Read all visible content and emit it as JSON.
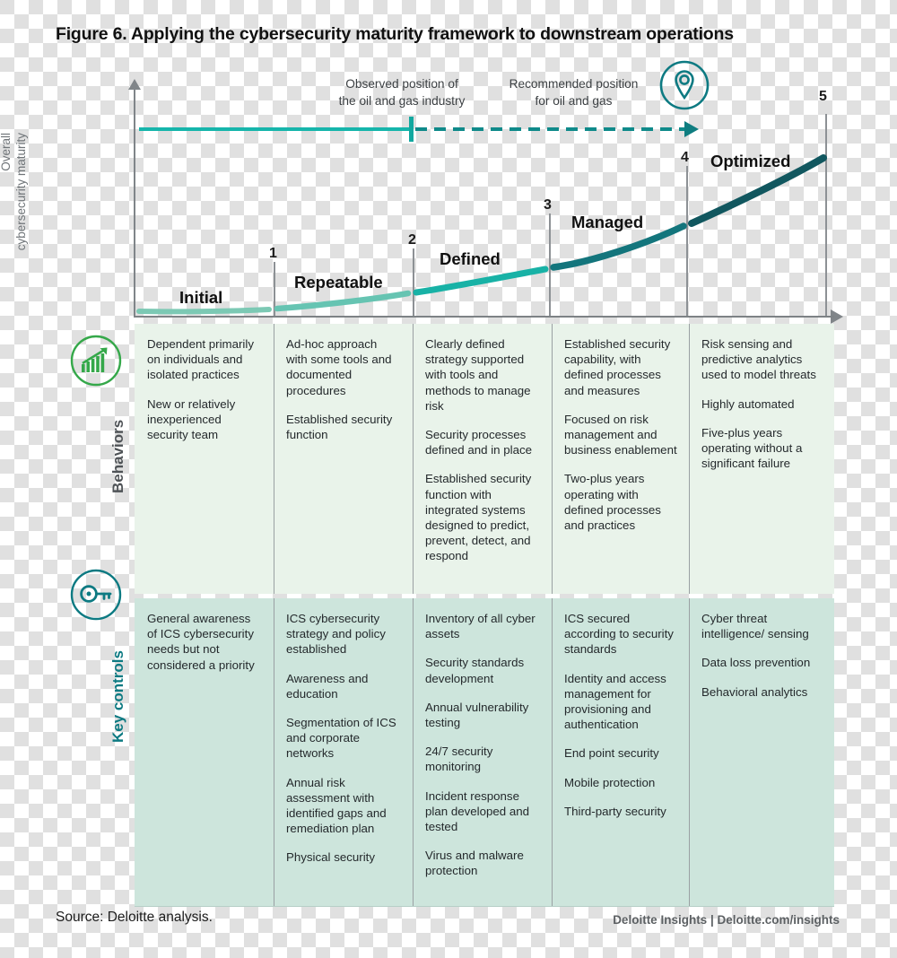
{
  "title": "Figure 6. Applying the cybersecurity maturity framework to downstream operations",
  "axis": {
    "y_label_line1": "Overall",
    "y_label_line2": "cybersecurity maturity"
  },
  "annotations": {
    "observed": "Observed position of\nthe oil and gas industry",
    "observed_line1": "Observed position of",
    "observed_line2": "the oil and gas industry",
    "recommended_line1": "Recommended position",
    "recommended_line2": "for oil and gas",
    "pin_icon": "location-pin-icon"
  },
  "colors": {
    "teal_light": "#7cc9b4",
    "teal_mid": "#18b2a6",
    "teal_dark": "#13757c",
    "teal_darkest": "#11575f",
    "accent": "#0f7d80",
    "behaviors_bg": "#e9f3ea",
    "controls_bg": "#cde5dc",
    "behaviors_icon": "#35a84a",
    "controls_icon": "#0d7a82"
  },
  "chart_data": {
    "type": "line",
    "title": "Overall cybersecurity maturity vs. maturity level",
    "xlabel": "",
    "ylabel": "Overall cybersecurity maturity",
    "xlim": [
      0,
      5
    ],
    "ylim": [
      0,
      5
    ],
    "grid": false,
    "legend": "none",
    "tick_labels": [
      "1",
      "2",
      "3",
      "4",
      "5"
    ],
    "level_names": [
      "Initial",
      "Repeatable",
      "Defined",
      "Managed",
      "Optimized"
    ],
    "x": [
      0,
      1,
      2,
      3,
      4,
      5
    ],
    "values": [
      0.12,
      0.18,
      0.45,
      1.0,
      1.9,
      3.3
    ],
    "annotations": [
      {
        "label": "Observed position of the oil and gas industry",
        "x": 1.95
      },
      {
        "label": "Recommended position for oil and gas",
        "x": 4.0
      }
    ]
  },
  "levels": [
    {
      "num": "1",
      "name": "Initial"
    },
    {
      "num": "2",
      "name": "Repeatable"
    },
    {
      "num": "3",
      "name": "Defined"
    },
    {
      "num": "4",
      "name": "Managed"
    },
    {
      "num": "5",
      "name": "Optimized"
    }
  ],
  "rows": [
    {
      "label": "Behaviors",
      "icon": "growth-chart-icon",
      "cells": [
        [
          "Dependent primarily on individuals and isolated practices",
          "New or relatively inexperienced security team"
        ],
        [
          "Ad-hoc approach with some tools and documented procedures",
          "Established security function"
        ],
        [
          "Clearly defined strategy supported with tools and methods to manage risk",
          "Security processes defined and in place",
          "Established security function with integrated systems designed to predict, prevent, detect, and respond"
        ],
        [
          "Established security capability, with defined processes and measures",
          "Focused on risk management and business enablement",
          "Two-plus years operating with defined processes and practices"
        ],
        [
          "Risk sensing and predictive analytics used to model threats",
          "Highly automated",
          "Five-plus years operating without a significant failure"
        ]
      ]
    },
    {
      "label": "Key controls",
      "icon": "key-icon",
      "cells": [
        [
          "General awareness of ICS cybersecurity needs but not considered a priority"
        ],
        [
          "ICS cybersecurity strategy and policy established",
          "Awareness and education",
          "Segmentation of ICS and corporate networks",
          "Annual risk assessment with identified gaps and remediation  plan",
          "Physical security"
        ],
        [
          "Inventory of all cyber assets",
          "Security standards development",
          "Annual vulnerability testing",
          "24/7 security monitoring",
          "Incident response plan developed and tested",
          "Virus and malware protection"
        ],
        [
          "ICS secured according to security standards",
          "Identity and access management for provisioning and authentication",
          "End point security",
          "Mobile protection",
          "Third-party security"
        ],
        [
          "Cyber threat intelligence/ sensing",
          "Data loss prevention",
          "Behavioral analytics"
        ]
      ]
    }
  ],
  "footer": {
    "source": "Source: Deloitte analysis.",
    "brand": "Deloitte Insights | Deloitte.com/insights"
  }
}
